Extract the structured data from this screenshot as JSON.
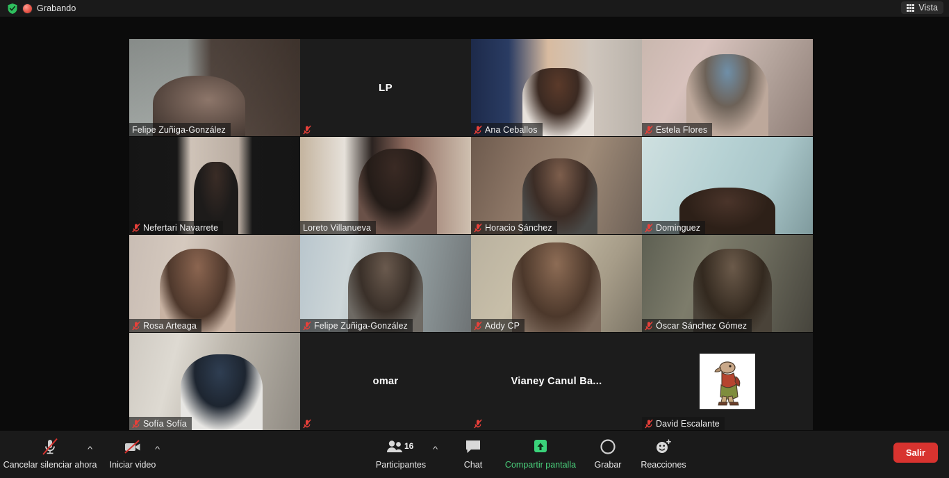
{
  "topbar": {
    "recording_label": "Grabando",
    "shield_icon": "security-shield-icon",
    "record_dot_icon": "recording-dot-icon",
    "view_label": "Vista",
    "view_icon": "grid-view-icon"
  },
  "grid": {
    "tiles": [
      {
        "name": "Felipe Zuñiga-González",
        "type": "video",
        "muted": false,
        "active": false,
        "scene": "s1"
      },
      {
        "name": "",
        "display": "LP",
        "type": "initials",
        "muted": true,
        "active": false,
        "scene": ""
      },
      {
        "name": "Ana Ceballos",
        "type": "video",
        "muted": true,
        "active": false,
        "scene": "s3"
      },
      {
        "name": "Estela Flores",
        "type": "video",
        "muted": true,
        "active": false,
        "scene": "s4"
      },
      {
        "name": "Nefertari Navarrete",
        "type": "video",
        "muted": true,
        "active": false,
        "scene": "s5"
      },
      {
        "name": "Loreto Villanueva",
        "type": "video",
        "muted": false,
        "active": true,
        "scene": "s6"
      },
      {
        "name": "Horacio Sánchez",
        "type": "video",
        "muted": true,
        "active": false,
        "scene": "s7"
      },
      {
        "name": "Dominguez",
        "type": "video",
        "muted": true,
        "active": false,
        "scene": "s8"
      },
      {
        "name": "Rosa Arteaga",
        "type": "video",
        "muted": true,
        "active": false,
        "scene": "s9"
      },
      {
        "name": "Felipe Zuñiga-González",
        "type": "video",
        "muted": true,
        "active": false,
        "scene": "s10"
      },
      {
        "name": "Addy CP",
        "type": "video",
        "muted": true,
        "active": false,
        "scene": "s11"
      },
      {
        "name": "Óscar Sánchez Gómez",
        "type": "video",
        "muted": true,
        "active": false,
        "scene": "s12"
      },
      {
        "name": "Sofía Sofía",
        "type": "video",
        "muted": true,
        "active": false,
        "scene": "s13"
      },
      {
        "name": "",
        "display": "omar",
        "type": "placeholder",
        "muted": true,
        "active": false,
        "scene": ""
      },
      {
        "name": "",
        "display": "Vianey Canul Ba...",
        "type": "placeholder",
        "muted": true,
        "active": false,
        "scene": ""
      },
      {
        "name": "David Escalante",
        "type": "avatar",
        "muted": true,
        "active": false,
        "scene": ""
      }
    ]
  },
  "toolbar": {
    "mute_label": "Cancelar silenciar ahora",
    "mute_icon": "microphone-muted-icon",
    "mute_caret_icon": "chevron-up-icon",
    "video_label": "Iniciar video",
    "video_icon": "video-off-icon",
    "video_caret_icon": "chevron-up-icon",
    "participants_label": "Participantes",
    "participants_count": "16",
    "participants_icon": "participants-icon",
    "participants_caret_icon": "chevron-up-icon",
    "chat_label": "Chat",
    "chat_icon": "chat-bubble-icon",
    "share_label": "Compartir pantalla",
    "share_icon": "share-screen-icon",
    "record_label": "Grabar",
    "record_icon": "record-circle-icon",
    "reactions_label": "Reacciones",
    "reactions_icon": "reactions-smiley-icon",
    "leave_label": "Salir"
  },
  "colors": {
    "accent_green": "#4ad17c",
    "leave_red": "#d8332f",
    "active_speaker": "#d4e13c",
    "mute_red": "#e8403a"
  }
}
